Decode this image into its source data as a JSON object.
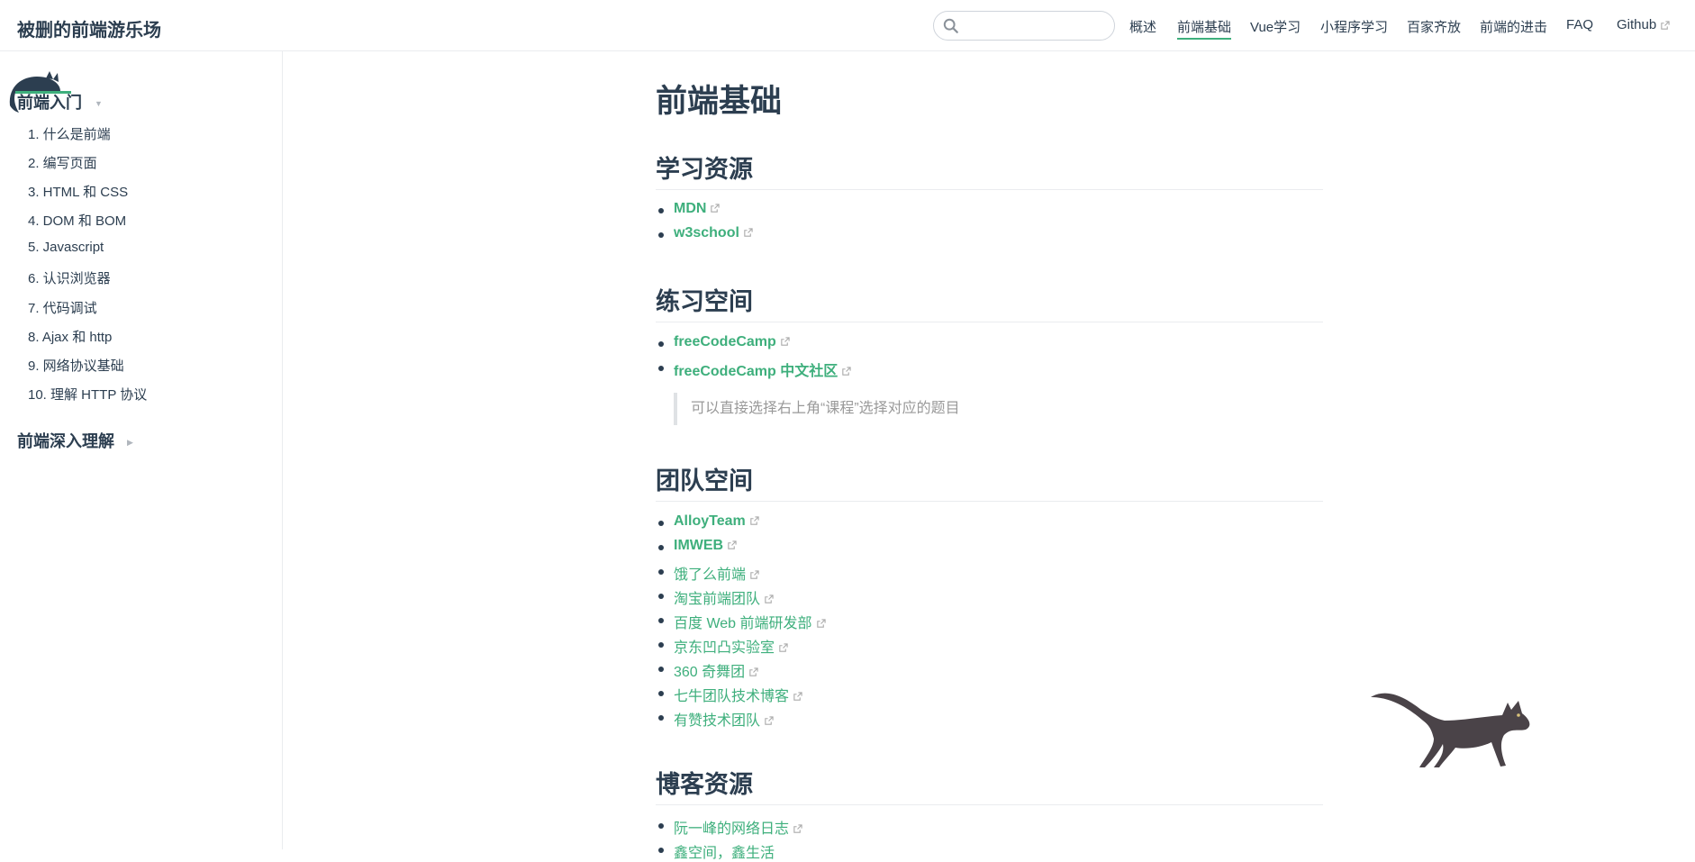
{
  "navbar": {
    "site_name": "被删的前端游乐场",
    "search_placeholder": "",
    "links": [
      "概述",
      "前端基础",
      "Vue学习",
      "小程序学习",
      "百家齐放",
      "前端的进击",
      "FAQ",
      "Github"
    ],
    "active": "前端基础"
  },
  "sidebar": {
    "groups": [
      {
        "title": "前端入门",
        "expanded": true,
        "items": [
          "1. 什么是前端",
          "2. 编写页面",
          "3. HTML 和 CSS",
          "4. DOM 和 BOM",
          "5. Javascript",
          "6. 认识浏览器",
          "7. 代码调试",
          "8. Ajax 和 http",
          "9. 网络协议基础",
          "10. 理解 HTTP 协议"
        ]
      },
      {
        "title": "前端深入理解",
        "expanded": false,
        "items": []
      }
    ]
  },
  "page": {
    "title": "前端基础",
    "sections": [
      {
        "heading": "学习资源",
        "links": [
          "MDN",
          "w3school"
        ]
      },
      {
        "heading": "练习空间",
        "links": [
          "freeCodeCamp",
          "freeCodeCamp 中文社区"
        ],
        "note": "可以直接选择右上角“课程”选择对应的题目"
      },
      {
        "heading": "团队空间",
        "links": [
          "AlloyTeam",
          "IMWEB",
          "饿了么前端",
          "淘宝前端团队",
          "百度 Web 前端研发部",
          "京东凹凸实验室",
          "360 奇舞团",
          "七牛团队技术博客",
          "有赞技术团队"
        ]
      },
      {
        "heading": "博客资源",
        "links": [
          "阮一峰的网络日志",
          "鑫空间，鑫生活"
        ]
      }
    ]
  },
  "colors": {
    "accent": "#3eaf7c",
    "text": "#2c3e50",
    "muted": "#999999"
  }
}
